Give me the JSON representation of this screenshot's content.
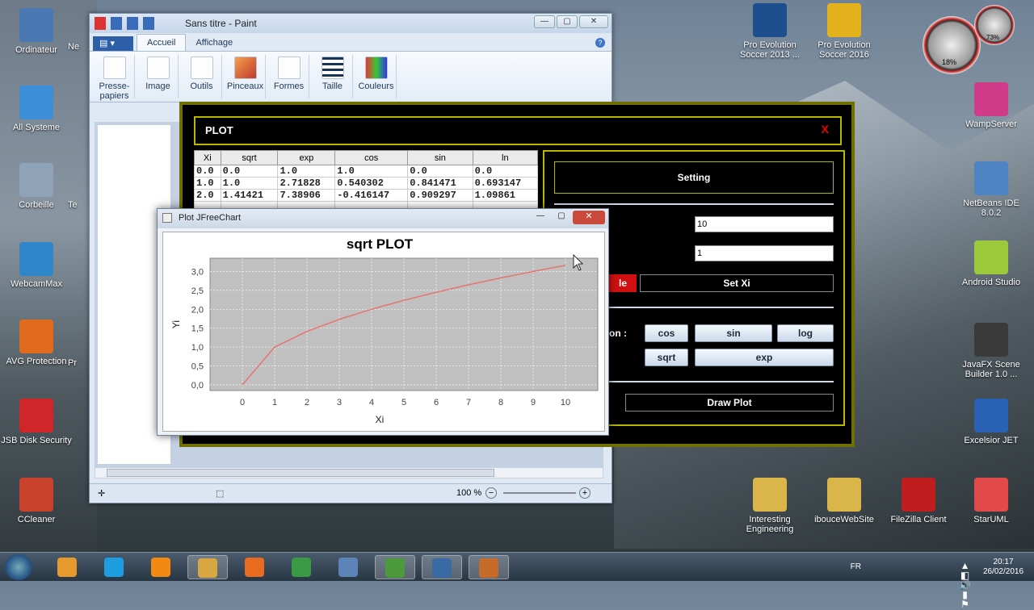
{
  "desktop": {
    "left_icons": [
      {
        "label": "Ordinateur",
        "icon": "computer-icon"
      },
      {
        "label": "All Systeme",
        "icon": "system-icon"
      },
      {
        "label": "Corbeille",
        "icon": "trash-icon"
      },
      {
        "label": "WebcamMax",
        "icon": "webcam-icon"
      },
      {
        "label": "AVG Protection",
        "icon": "avg-icon"
      },
      {
        "label": "JSB Disk Security",
        "icon": "shield-icon"
      },
      {
        "label": "CCleaner",
        "icon": "ccleaner-icon"
      }
    ],
    "left_partial_labels": [
      "Ne",
      "Te",
      "Pr"
    ],
    "right_icons": [
      {
        "label": "Pro Evolution Soccer 2013 ...",
        "icon": "game-icon"
      },
      {
        "label": "Pro Evolution Soccer 2016",
        "icon": "game-icon"
      },
      {
        "label": "WampServer",
        "icon": "wamp-icon"
      },
      {
        "label": "NetBeans IDE 8.0.2",
        "icon": "netbeans-icon"
      },
      {
        "label": "Android Studio",
        "icon": "android-icon"
      },
      {
        "label": "JavaFX Scene Builder 1.0 ...",
        "icon": "javafx-icon"
      },
      {
        "label": "Excelsior JET",
        "icon": "excelsior-icon"
      },
      {
        "label": "Interesting Engineering",
        "icon": "folder-icon"
      },
      {
        "label": "ibouceWebSite",
        "icon": "folder-icon"
      },
      {
        "label": "FileZilla Client",
        "icon": "filezilla-icon"
      },
      {
        "label": "StarUML",
        "icon": "staruml-icon"
      }
    ],
    "gadget": {
      "cpu": "18%",
      "ram": "73%"
    }
  },
  "paint": {
    "title": "Sans titre - Paint",
    "tabs": [
      "Accueil",
      "Affichage"
    ],
    "groups": [
      "Presse-papiers",
      "Image",
      "Outils",
      "Pinceaux",
      "Formes",
      "Taille",
      "Couleurs"
    ],
    "zoom": "100 %"
  },
  "plot_window": {
    "title": "PLOT",
    "close": "X",
    "table": {
      "headers": [
        "Xi",
        "sqrt",
        "exp",
        "cos",
        "sin",
        "ln"
      ],
      "rows": [
        [
          "0.0",
          "0.0",
          "1.0",
          "1.0",
          "0.0",
          "0.0"
        ],
        [
          "1.0",
          "1.0",
          "2.71828",
          "0.540302",
          "0.841471",
          "0.693147"
        ],
        [
          "2.0",
          "1.41421",
          "7.38906",
          "-0.416147",
          "0.909297",
          "1.09861"
        ]
      ]
    },
    "setting_label": "Setting",
    "input_max": "10",
    "input_step": "1",
    "partial_red_button": "le",
    "set_xi": "Set Xi",
    "fn_label": "on :",
    "fn_buttons": [
      "cos",
      "sin",
      "log",
      "sqrt",
      "exp"
    ],
    "draw_plot": "Draw Plot"
  },
  "chart_window": {
    "title": "Plot JFreeChart"
  },
  "chart_data": {
    "type": "line",
    "title": "sqrt PLOT",
    "xlabel": "Xi",
    "ylabel": "Yi",
    "x": [
      0,
      1,
      2,
      3,
      4,
      5,
      6,
      7,
      8,
      9,
      10
    ],
    "series": [
      {
        "values": [
          0,
          1.0,
          1.414,
          1.732,
          2.0,
          2.236,
          2.449,
          2.646,
          2.828,
          3.0,
          3.162
        ]
      }
    ],
    "xlim": [
      -1,
      11
    ],
    "ylim": [
      -0.15,
      3.35
    ],
    "xticks": [
      "0",
      "1",
      "2",
      "3",
      "4",
      "5",
      "6",
      "7",
      "8",
      "9",
      "10"
    ],
    "yticks": [
      "0,0",
      "0,5",
      "1,0",
      "1,5",
      "2,0",
      "2,5",
      "3,0"
    ],
    "line_color": "#e8706a",
    "plot_bg": "#c0c0c0"
  },
  "taskbar": {
    "apps": [
      "start",
      "media-player",
      "skype",
      "vlc",
      "explorer",
      "firefox",
      "chrome",
      "virtualbox",
      "spreadsheet",
      "paint",
      "java"
    ],
    "lang": "FR",
    "time": "20:17",
    "date": "26/02/2016"
  }
}
